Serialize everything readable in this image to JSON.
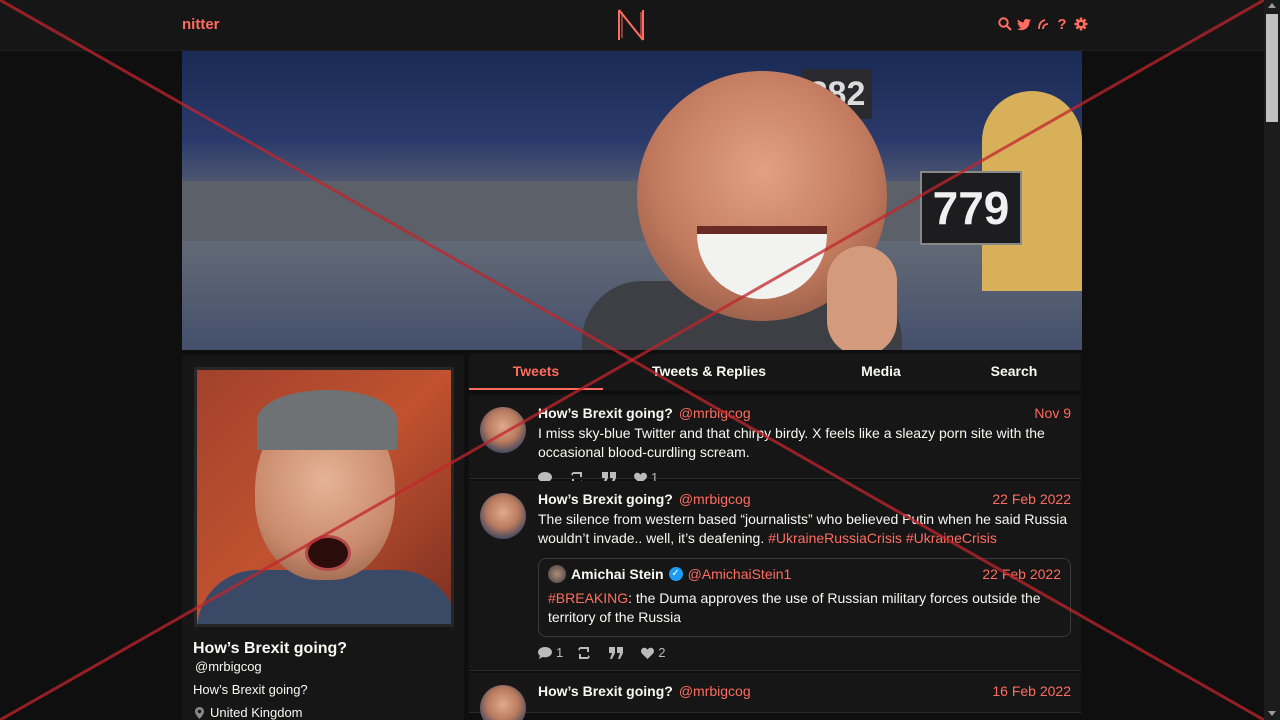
{
  "navbar": {
    "brand": "nitter",
    "logo_letter": "N",
    "icons": [
      "search-icon",
      "twitter-bird-icon",
      "rss-icon",
      "help-icon",
      "gear-icon"
    ],
    "help_glyph": "?"
  },
  "banner": {
    "placard_number": "779",
    "placard_number_2": "882"
  },
  "profile": {
    "name": "How’s Brexit going?",
    "handle": "@mrbigcog",
    "bio": "How’s Brexit going?",
    "location": "United Kingdom"
  },
  "tabs": [
    {
      "label": "Tweets",
      "active": true
    },
    {
      "label": "Tweets & Replies",
      "active": false
    },
    {
      "label": "Media",
      "active": false
    },
    {
      "label": "Search",
      "active": false
    }
  ],
  "tweets": [
    {
      "name": "How’s Brexit going?",
      "handle": "@mrbigcog",
      "date": "Nov 9",
      "text": "I miss sky-blue Twitter and that chirpy birdy. X feels like a sleazy porn site with the occasional blood-curdling scream.",
      "stats": {
        "comments": "",
        "retweets": "",
        "quotes": "",
        "likes": "1"
      }
    },
    {
      "name": "How’s Brexit going?",
      "handle": "@mrbigcog",
      "date": "22 Feb 2022",
      "text": "The silence from western based “journalists” who believed Putin when he said Russia wouldn’t invade.. well, it’s deafening. ",
      "hashtags": [
        "#UkraineRussiaCrisis",
        "#UkraineCrisis"
      ],
      "quote": {
        "name": "Amichai Stein",
        "verified_mark": "✓",
        "handle": "@AmichaiStein1",
        "date": "22 Feb 2022",
        "hashtag": "#BREAKING",
        "text": ": the Duma approves the use of Russian military forces outside the territory of the Russia"
      },
      "stats": {
        "comments": "1",
        "retweets": "",
        "quotes": "",
        "likes": "2"
      }
    },
    {
      "name": "How’s Brexit going?",
      "handle": "@mrbigcog",
      "date": "16 Feb 2022",
      "text": ""
    }
  ],
  "colors": {
    "accent": "#ff6c60",
    "background": "#0f0f0f",
    "panel": "#161616",
    "text": "#f8f8f2",
    "cross": "#c0262c"
  }
}
